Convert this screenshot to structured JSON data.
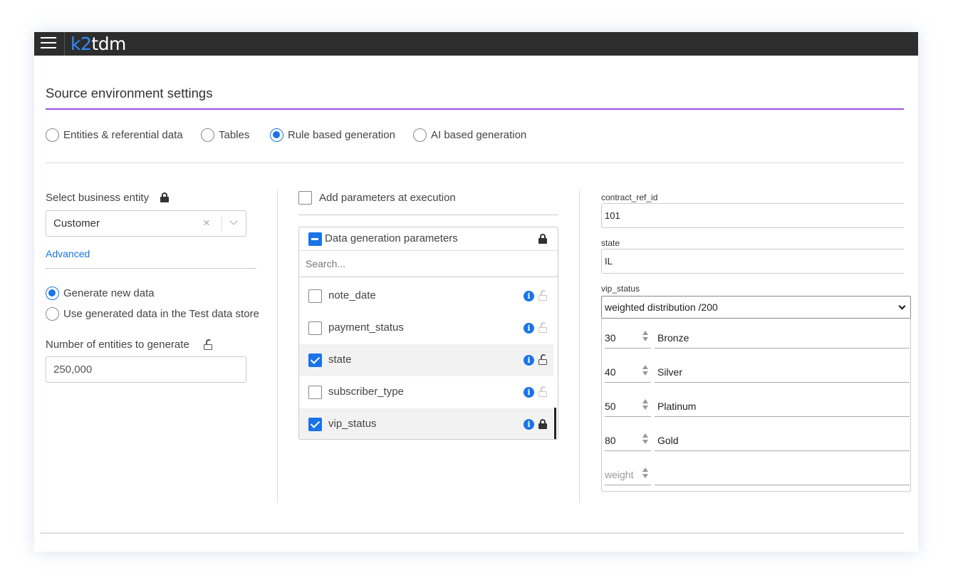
{
  "app": {
    "logo_prefix": "k2",
    "logo_suffix": "tdm"
  },
  "page": {
    "title": "Source environment settings"
  },
  "source_types": [
    {
      "label": "Entities & referential data",
      "checked": false
    },
    {
      "label": "Tables",
      "checked": false
    },
    {
      "label": "Rule based generation",
      "checked": true
    },
    {
      "label": "AI based generation",
      "checked": false
    }
  ],
  "left": {
    "business_entity_label": "Select business entity",
    "business_entity_value": "Customer",
    "clear_symbol": "×",
    "advanced_link": "Advanced",
    "generate_options": [
      {
        "label": "Generate new data",
        "checked": true
      },
      {
        "label": "Use generated data in the Test data store",
        "checked": false
      }
    ],
    "entity_count_label": "Number of entities to generate",
    "entity_count_value": "250,000"
  },
  "middle": {
    "add_params_label": "Add parameters at execution",
    "add_params_checked": false,
    "panel_title": "Data generation parameters",
    "search_placeholder": "Search...",
    "info_glyph": "i",
    "params": [
      {
        "name": "note_date",
        "checked": false,
        "locked": false,
        "selected": false
      },
      {
        "name": "payment_status",
        "checked": false,
        "locked": false,
        "selected": false
      },
      {
        "name": "state",
        "checked": true,
        "locked": false,
        "selected": true
      },
      {
        "name": "subscriber_type",
        "checked": false,
        "locked": false,
        "selected": false
      },
      {
        "name": "vip_status",
        "checked": true,
        "locked": true,
        "selected": true
      }
    ]
  },
  "right": {
    "fields": [
      {
        "label": "contract_ref_id",
        "value": "101"
      },
      {
        "label": "state",
        "value": "IL"
      }
    ],
    "vip_label": "vip_status",
    "vip_dropdown_value": "weighted distribution /200",
    "weights": [
      {
        "weight": "30",
        "value": "Bronze"
      },
      {
        "weight": "40",
        "value": "Silver"
      },
      {
        "weight": "50",
        "value": "Platinum"
      },
      {
        "weight": "80",
        "value": "Gold"
      }
    ],
    "weight_placeholder": "weight"
  },
  "colors": {
    "accent": "#1a73e8",
    "title_rule": "#9b51e0",
    "topbar": "#2d2d2d"
  }
}
